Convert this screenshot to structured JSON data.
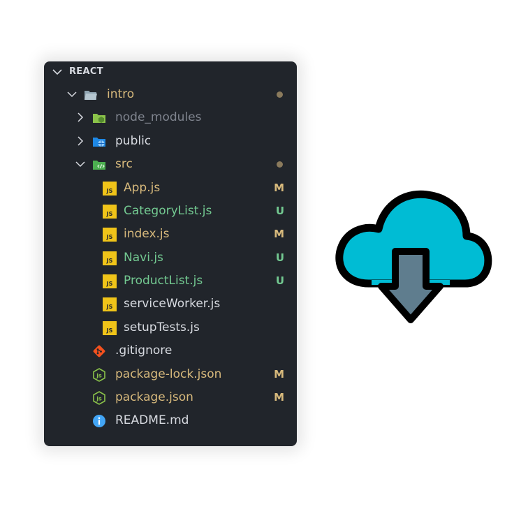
{
  "explorer": {
    "section_title": "REACT",
    "rows": [
      {
        "label": "intro",
        "type": "folder-open",
        "badge": "",
        "dot": true
      },
      {
        "label": "node_modules",
        "type": "folder",
        "badge": "",
        "dot": false
      },
      {
        "label": "public",
        "type": "folder",
        "badge": "",
        "dot": false
      },
      {
        "label": "src",
        "type": "folder-open",
        "badge": "",
        "dot": true
      },
      {
        "label": "App.js",
        "type": "file-js",
        "badge": "M"
      },
      {
        "label": "CategoryList.js",
        "type": "file-js",
        "badge": "U"
      },
      {
        "label": "index.js",
        "type": "file-js",
        "badge": "M"
      },
      {
        "label": "Navi.js",
        "type": "file-js",
        "badge": "U"
      },
      {
        "label": "ProductList.js",
        "type": "file-js",
        "badge": "U"
      },
      {
        "label": "serviceWorker.js",
        "type": "file-js",
        "badge": ""
      },
      {
        "label": "setupTests.js",
        "type": "file-js",
        "badge": ""
      },
      {
        "label": ".gitignore",
        "type": "file-git",
        "badge": ""
      },
      {
        "label": "package-lock.json",
        "type": "file-node",
        "badge": "M"
      },
      {
        "label": "package.json",
        "type": "file-node",
        "badge": "M"
      },
      {
        "label": "README.md",
        "type": "file-info",
        "badge": ""
      }
    ],
    "js_icon_text": "JS"
  },
  "colors": {
    "panel_bg": "#21252b",
    "modified": "#d7b97c",
    "untracked": "#73c991",
    "ignored": "#7f848e",
    "dot": "#8a7a5c",
    "cloud_fill": "#00bcd4",
    "arrow_fill": "#5f7d8e"
  },
  "icons": {
    "download": "cloud-download-icon"
  }
}
